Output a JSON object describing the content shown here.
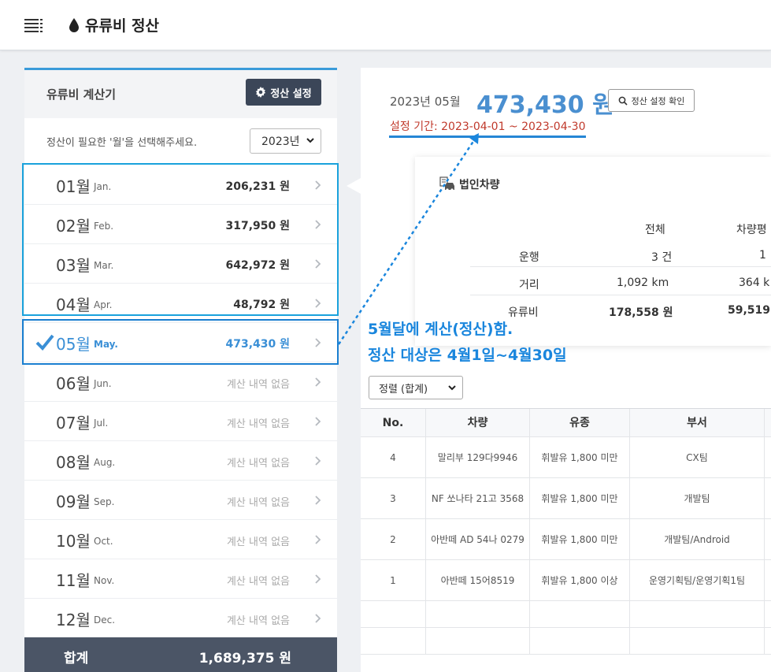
{
  "app": {
    "title": "유류비 정산"
  },
  "sidebar": {
    "title": "유류비 계산기",
    "settle_button": "정산 설정",
    "select_hint": "정산이 필요한 '월'을 선택해주세요.",
    "year": "2023년",
    "months": [
      {
        "num": "01월",
        "abbr": "Jan.",
        "amount": "206,231 원",
        "has": true
      },
      {
        "num": "02월",
        "abbr": "Feb.",
        "amount": "317,950 원",
        "has": true
      },
      {
        "num": "03월",
        "abbr": "Mar.",
        "amount": "642,972 원",
        "has": true
      },
      {
        "num": "04월",
        "abbr": "Apr.",
        "amount": "48,792 원",
        "has": true
      },
      {
        "num": "05월",
        "abbr": "May.",
        "amount": "473,430 원",
        "has": true,
        "active": true
      },
      {
        "num": "06월",
        "abbr": "Jun.",
        "amount": "계산 내역 없음",
        "has": false
      },
      {
        "num": "07월",
        "abbr": "Jul.",
        "amount": "계산 내역 없음",
        "has": false
      },
      {
        "num": "08월",
        "abbr": "Aug.",
        "amount": "계산 내역 없음",
        "has": false
      },
      {
        "num": "09월",
        "abbr": "Sep.",
        "amount": "계산 내역 없음",
        "has": false
      },
      {
        "num": "10월",
        "abbr": "Oct.",
        "amount": "계산 내역 없음",
        "has": false
      },
      {
        "num": "11월",
        "abbr": "Nov.",
        "amount": "계산 내역 없음",
        "has": false
      },
      {
        "num": "12월",
        "abbr": "Dec.",
        "amount": "계산 내역 없음",
        "has": false
      }
    ],
    "total_label": "합계",
    "total_value": "1,689,375 원"
  },
  "main": {
    "date": "2023년 05월",
    "amount": "473,430 원",
    "check_button": "정산 설정 확인",
    "period": "설정 기간: 2023-04-01 ~ 2023-04-30",
    "car_card": {
      "title": "법인차량",
      "col_total": "전체",
      "col_avg": "차량평",
      "rows": [
        {
          "label": "운행",
          "total": "3 건",
          "avg": "1"
        },
        {
          "label": "거리",
          "total": "1,092 km",
          "avg": "364 k"
        },
        {
          "label": "유류비",
          "total": "178,558 원",
          "avg": "59,519"
        }
      ]
    },
    "annotation_line1": "5월달에 계산(정산)함.",
    "annotation_line2": "정산 대상은 4월1일~4월30일",
    "sort": "정렬 (합계)",
    "table": {
      "headers": [
        "No.",
        "차량",
        "유종",
        "부서"
      ],
      "rows": [
        {
          "no": "4",
          "car": "말리부 129다9946",
          "fuel": "휘발유 1,800 미만",
          "dept": "CX팀"
        },
        {
          "no": "3",
          "car": "NF 쏘나타 21고 3568",
          "fuel": "휘발유 1,800 미만",
          "dept": "개발팀"
        },
        {
          "no": "2",
          "car": "아반떼 AD 54나 0279",
          "fuel": "휘발유 1,800 미만",
          "dept": "개발팀/Android"
        },
        {
          "no": "1",
          "car": "아반떼 15어8519",
          "fuel": "휘발유 1,800 이상",
          "dept": "운영기획팀/운영기획1팀"
        }
      ]
    }
  },
  "colors": {
    "accent": "#3a8fd6",
    "highlight": "#1aa2dc",
    "period": "#c0392b",
    "dark": "#3b4658"
  }
}
